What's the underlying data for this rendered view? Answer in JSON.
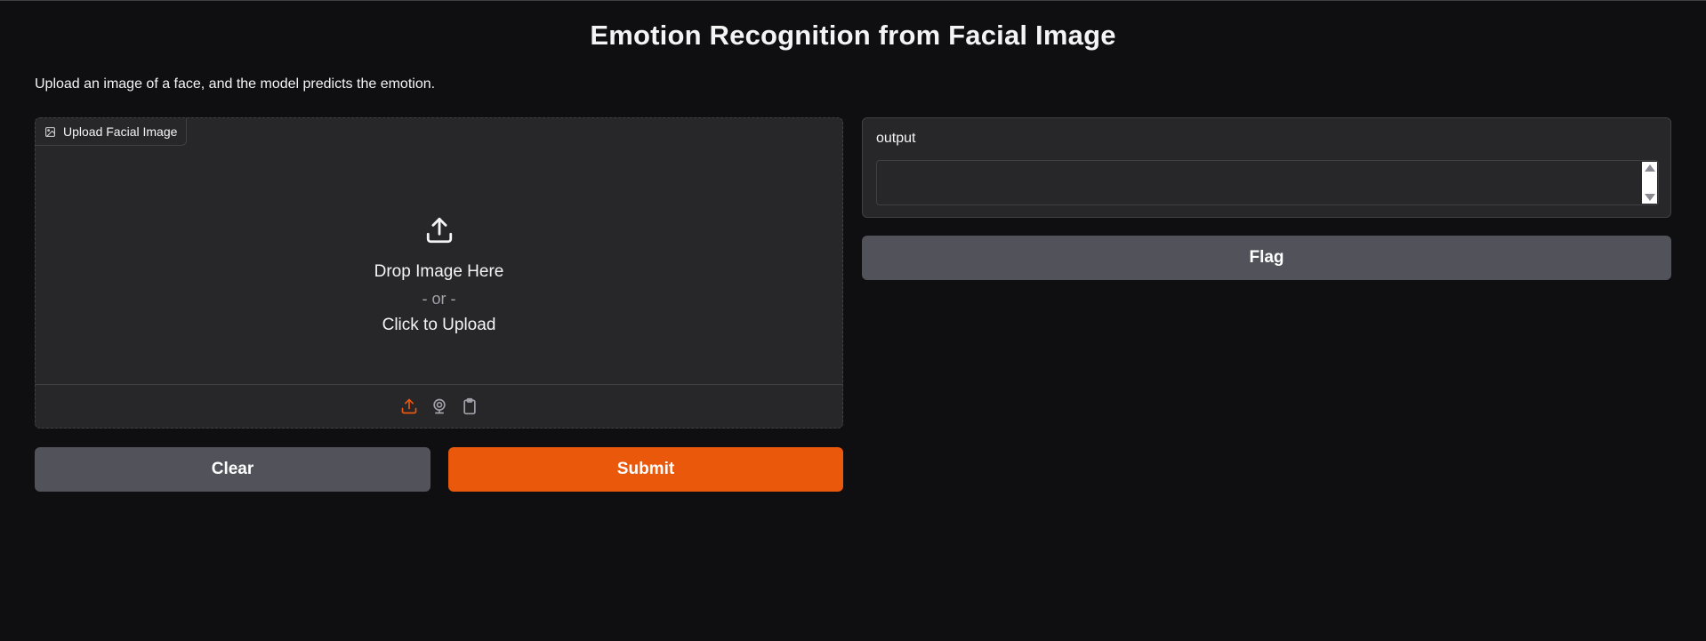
{
  "app": {
    "title": "Emotion Recognition from Facial Image",
    "description": "Upload an image of a face, and the model predicts the emotion."
  },
  "image_input": {
    "label": "Upload Facial Image",
    "drop_text": "Drop Image Here",
    "or_text": "- or -",
    "click_text": "Click to Upload",
    "sources": [
      "upload-icon",
      "webcam-icon",
      "clipboard-icon"
    ],
    "active_source_color": "#ea580c"
  },
  "output": {
    "label": "output",
    "value": ""
  },
  "buttons": {
    "clear": "Clear",
    "submit": "Submit",
    "flag": "Flag"
  },
  "colors": {
    "background": "#0f0f11",
    "panel": "#27272a",
    "secondary_button": "#52525b",
    "primary_button": "#ea580c"
  }
}
